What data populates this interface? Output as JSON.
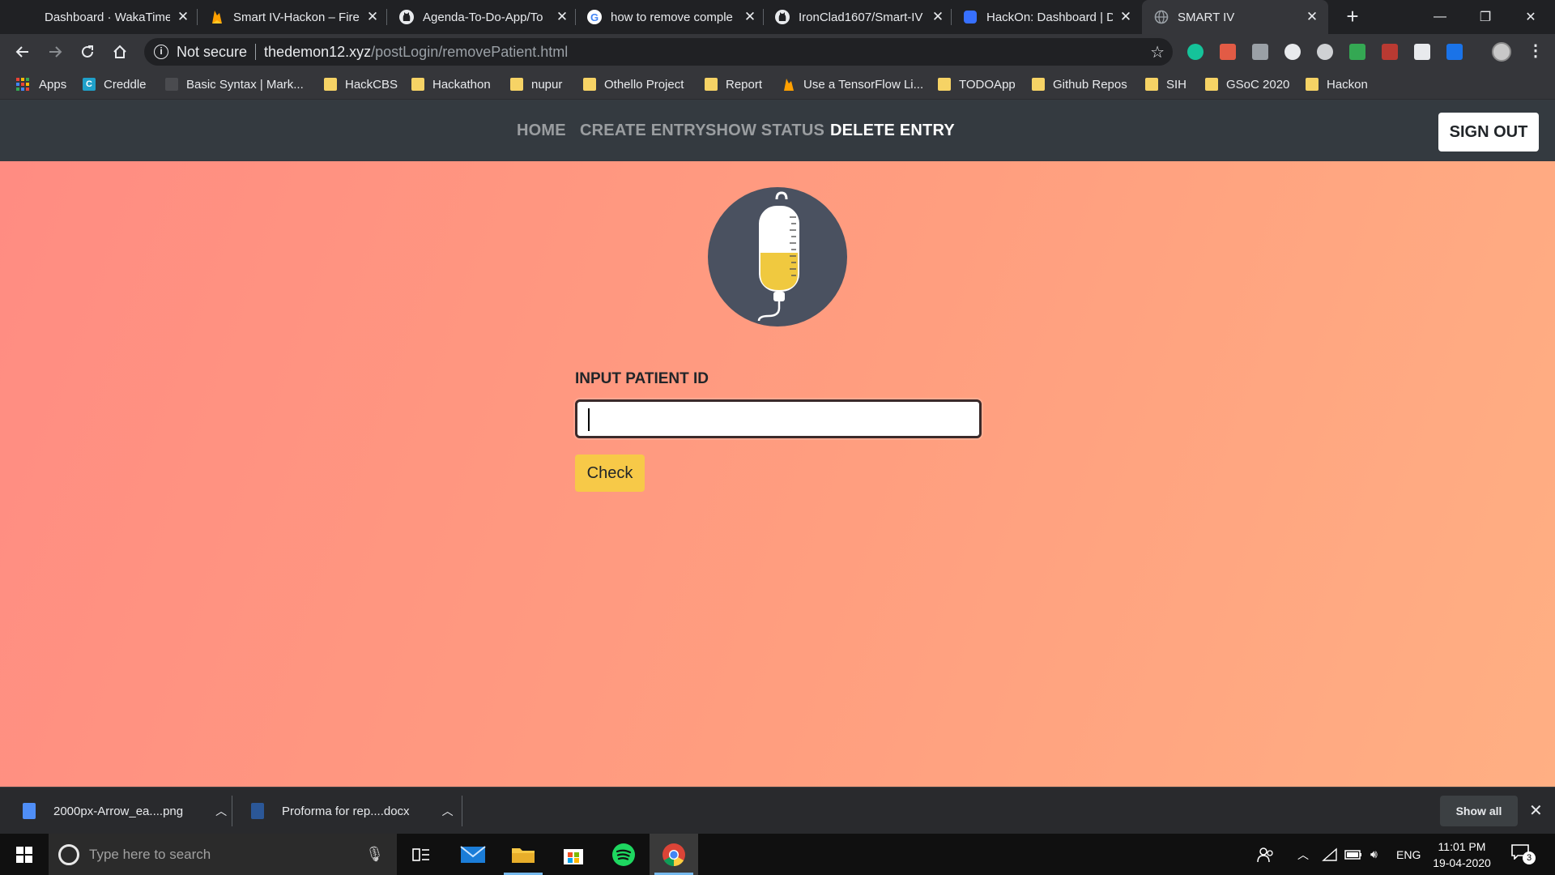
{
  "browser": {
    "tabs": [
      {
        "title": "Dashboard · WakaTime",
        "icon": "wakatime-icon"
      },
      {
        "title": "Smart IV-Hackon – Fire",
        "icon": "firebase-icon"
      },
      {
        "title": "Agenda-To-Do-App/To",
        "icon": "github-icon"
      },
      {
        "title": "how to remove comple",
        "icon": "google-icon"
      },
      {
        "title": "IronClad1607/Smart-IV",
        "icon": "github-icon"
      },
      {
        "title": "HackOn: Dashboard | D",
        "icon": "devfolio-icon"
      },
      {
        "title": "SMART IV",
        "icon": "globe-icon"
      }
    ],
    "tab_close_glyph": "✕",
    "new_tab_glyph": "+",
    "window_controls": {
      "minimize": "—",
      "restore": "❐",
      "close": "✕"
    },
    "omnibox": {
      "security_label": "Not secure",
      "host": "thedemon12.xyz",
      "path": "/postLogin/removePatient.html"
    },
    "bookmarks": [
      {
        "label": "Apps",
        "type": "apps"
      },
      {
        "label": "Creddle",
        "type": "site"
      },
      {
        "label": "Basic Syntax | Mark...",
        "type": "site"
      },
      {
        "label": "HackCBS",
        "type": "folder"
      },
      {
        "label": "Hackathon",
        "type": "folder"
      },
      {
        "label": "nupur",
        "type": "folder"
      },
      {
        "label": "Othello Project",
        "type": "folder"
      },
      {
        "label": "Report",
        "type": "folder"
      },
      {
        "label": "Use a TensorFlow Li...",
        "type": "site"
      },
      {
        "label": "TODOApp",
        "type": "folder"
      },
      {
        "label": "Github Repos",
        "type": "folder"
      },
      {
        "label": "SIH",
        "type": "folder"
      },
      {
        "label": "GSoC 2020",
        "type": "folder"
      },
      {
        "label": "Hackon",
        "type": "folder"
      }
    ]
  },
  "site": {
    "nav": {
      "home": "HOME",
      "create_entry": "CREATE ENTRY",
      "show_status": "SHOW STATUS",
      "delete_entry": "DELETE ENTRY",
      "sign_out": "SIGN OUT",
      "active": "DELETE ENTRY"
    },
    "form": {
      "label": "INPUT PATIENT ID",
      "input_value": "",
      "button_label": "Check"
    },
    "logo_icon": "iv-bag-icon",
    "colors": {
      "navbar": "#343a40",
      "gradient_start": "#ff8c82",
      "gradient_end": "#ffaf83",
      "button": "#f7c948"
    }
  },
  "downloads": {
    "items": [
      {
        "name": "2000px-Arrow_ea....png",
        "icon": "image-file-icon"
      },
      {
        "name": "Proforma for rep....docx",
        "icon": "word-file-icon"
      }
    ],
    "show_all": "Show all"
  },
  "taskbar": {
    "search_placeholder": "Type here to search",
    "language": "ENG",
    "time": "11:01 PM",
    "date": "19-04-2020",
    "notification_count": "3"
  }
}
